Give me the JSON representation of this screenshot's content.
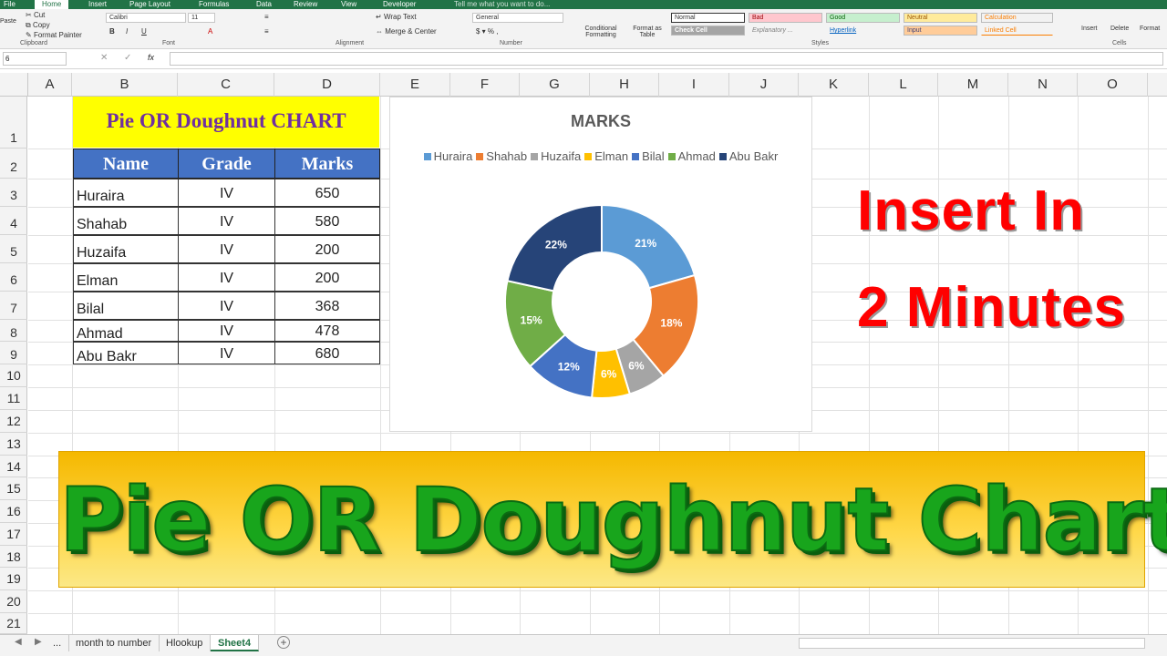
{
  "ribbon_tabs": [
    "File",
    "Home",
    "Insert",
    "Page Layout",
    "Formulas",
    "Data",
    "Review",
    "View",
    "Developer",
    "Tell me what you want to do..."
  ],
  "ribbon": {
    "clipboard": {
      "cut": "Cut",
      "copy": "Copy",
      "format_painter": "Format Painter",
      "paste": "Paste",
      "group": "Clipboard"
    },
    "font": {
      "name": "Calibri",
      "size": "11",
      "group": "Font"
    },
    "alignment": {
      "wrap": "Wrap Text",
      "merge": "Merge & Center",
      "group": "Alignment"
    },
    "number": {
      "format": "General",
      "group": "Number"
    },
    "styles": {
      "conditional": "Conditional Formatting",
      "format_table": "Format as Table",
      "normal": "Normal",
      "bad": "Bad",
      "good": "Good",
      "neutral": "Neutral",
      "calculation": "Calculation",
      "check_cell": "Check Cell",
      "explanatory": "Explanatory ...",
      "hyperlink": "Hyperlink",
      "input": "Input",
      "linked_cell": "Linked Cell",
      "group": "Styles"
    },
    "cells": {
      "insert": "Insert",
      "delete": "Delete",
      "format": "Format",
      "group": "Cells"
    }
  },
  "formula_bar": {
    "name_box": "6",
    "fx": "fx"
  },
  "columns": [
    "A",
    "B",
    "C",
    "D",
    "E",
    "F",
    "G",
    "H",
    "I",
    "J",
    "K",
    "L",
    "M",
    "N",
    "O"
  ],
  "rows": [
    "1",
    "2",
    "3",
    "4",
    "5",
    "6",
    "7",
    "8",
    "9",
    "10",
    "11",
    "12",
    "13",
    "14",
    "15",
    "16",
    "17",
    "18",
    "19",
    "20",
    "21"
  ],
  "table": {
    "title": "Pie OR Doughnut CHART",
    "headers": [
      "Name",
      "Grade",
      "Marks"
    ],
    "rows": [
      [
        "Huraira",
        "IV",
        "650"
      ],
      [
        "Shahab",
        "IV",
        "580"
      ],
      [
        "Huzaifa",
        "IV",
        "200"
      ],
      [
        "Elman",
        "IV",
        "200"
      ],
      [
        "Bilal",
        "IV",
        "368"
      ],
      [
        "Ahmad",
        "IV",
        "478"
      ],
      [
        "Abu Bakr",
        "IV",
        "680"
      ]
    ]
  },
  "chart_data": {
    "type": "pie",
    "subtype": "doughnut",
    "title": "MARKS",
    "categories": [
      "Huraira",
      "Shahab",
      "Huzaifa",
      "Elman",
      "Bilal",
      "Ahmad",
      "Abu Bakr"
    ],
    "values": [
      650,
      580,
      200,
      200,
      368,
      478,
      680
    ],
    "labels": [
      "21%",
      "18%",
      "6%",
      "6%",
      "12%",
      "15%",
      "22%"
    ],
    "colors": [
      "#5b9bd5",
      "#ed7d31",
      "#a5a5a5",
      "#ffc000",
      "#4472c4",
      "#70ad47",
      "#264478"
    ],
    "legend": "top"
  },
  "overlay": {
    "line1": "Insert In",
    "line2": "2 Minutes",
    "banner": "Pie OR Doughnut Chart"
  },
  "sheet_tabs": [
    "...",
    "month to number",
    "Hlookup",
    "Sheet4"
  ],
  "add_sheet": "+"
}
